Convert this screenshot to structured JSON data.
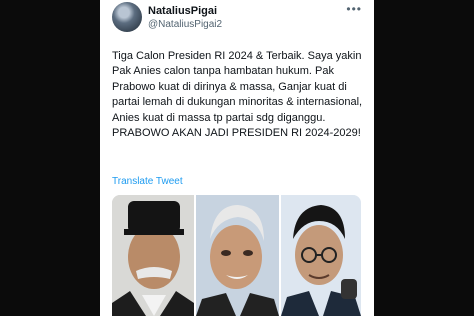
{
  "tweet": {
    "display_name": "NataliusPigai",
    "handle": "@NataliusPigai2",
    "more_icon": "more-horizontal-icon",
    "text": "Tiga Calon Presiden RI 2024 & Terbaik. Saya yakin Pak Anies calon tanpa hambatan hukum. Pak Prabowo kuat di dirinya & massa, Ganjar kuat di partai lemah di dukungan minoritas & internasional, Anies kuat di massa tp partai sdg diganggu. PRABOWO AKAN JADI PRESIDEN RI 2024-2029!",
    "translate_label": "Translate Tweet",
    "link_color": "#1d9bf0"
  },
  "photos": [
    {
      "icon": "portrait-photo"
    },
    {
      "icon": "portrait-photo"
    },
    {
      "icon": "portrait-photo"
    }
  ]
}
